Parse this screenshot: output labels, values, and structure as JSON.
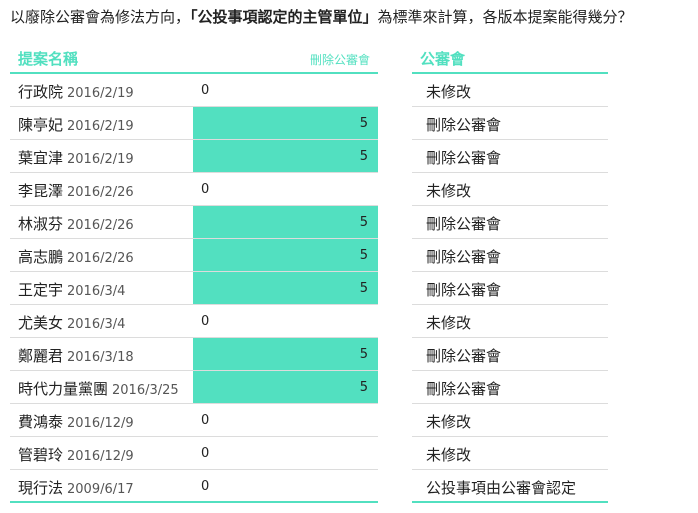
{
  "question": {
    "part1": "以廢除公審會為修法方向，",
    "part2": "「公投事項認定的主管單位」",
    "part3": "為標準來計算，各版本提案能得幾分？"
  },
  "left_table": {
    "header": "提案名稱",
    "subheader": "刪除公審會",
    "rows": [
      {
        "name": "行政院",
        "date": "2016/2/19",
        "score": "0"
      },
      {
        "name": "陳亭妃",
        "date": "2016/2/19",
        "score": "5"
      },
      {
        "name": "葉宜津",
        "date": "2016/2/19",
        "score": "5"
      },
      {
        "name": "李昆澤",
        "date": "2016/2/26",
        "score": "0"
      },
      {
        "name": "林淑芬",
        "date": "2016/2/26",
        "score": "5"
      },
      {
        "name": "高志鵬",
        "date": "2016/2/26",
        "score": "5"
      },
      {
        "name": "王定宇",
        "date": "2016/3/4",
        "score": "5"
      },
      {
        "name": "尤美女",
        "date": "2016/3/4",
        "score": "0"
      },
      {
        "name": "鄭麗君",
        "date": "2016/3/18",
        "score": "5"
      },
      {
        "name": "時代力量黨團",
        "date": "2016/3/25",
        "score": "5"
      },
      {
        "name": "費鴻泰",
        "date": "2016/12/9",
        "score": "0"
      },
      {
        "name": "管碧玲",
        "date": "2016/12/9",
        "score": "0"
      },
      {
        "name": "現行法",
        "date": "2009/6/17",
        "score": "0"
      }
    ]
  },
  "right_table": {
    "header": "公審會",
    "rows": [
      "未修改",
      "刪除公審會",
      "刪除公審會",
      "未修改",
      "刪除公審會",
      "刪除公審會",
      "刪除公審會",
      "未修改",
      "刪除公審會",
      "刪除公審會",
      "未修改",
      "未修改",
      "公投事項由公審會認定"
    ]
  },
  "score_max": 5,
  "colors": {
    "accent": "#52e0c0",
    "text": "#222222",
    "divider": "#dcdcdc"
  }
}
